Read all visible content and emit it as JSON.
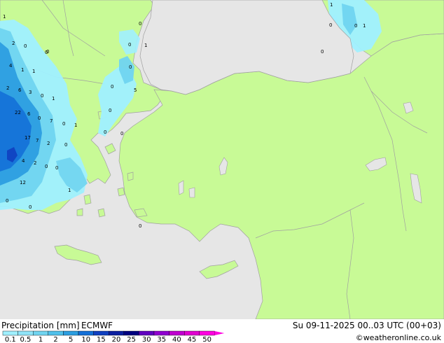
{
  "legend": {
    "title": "Precipitation [mm]",
    "model": "ECMWF",
    "datetime": "Su 09-11-2025 00..03 UTC (00+03)",
    "credit": "©weatheronline.co.uk",
    "ticks": [
      "0.1",
      "0.5",
      "1",
      "2",
      "5",
      "10",
      "15",
      "20",
      "25",
      "30",
      "35",
      "40",
      "45",
      "50"
    ],
    "colors": [
      "#a0f0ff",
      "#90e4f8",
      "#70d4f0",
      "#50c0ea",
      "#2c9ee0",
      "#1470d8",
      "#1040c0",
      "#0c20a0",
      "#000080",
      "#6000c0",
      "#9000d0",
      "#c000d0",
      "#e000d0",
      "#ff00e0"
    ]
  },
  "map": {
    "colors": {
      "sea": "#e6e6e6",
      "land": "#c8fa96",
      "border": "#a0a0a0"
    },
    "value_labels": [
      {
        "text": "1"
      },
      {
        "text": "2"
      },
      {
        "text": "0"
      },
      {
        "text": "0"
      },
      {
        "text": "4"
      },
      {
        "text": "1"
      },
      {
        "text": "1"
      },
      {
        "text": "2"
      },
      {
        "text": "6"
      },
      {
        "text": "3"
      },
      {
        "text": "0"
      },
      {
        "text": "1"
      },
      {
        "text": "22"
      },
      {
        "text": "6"
      },
      {
        "text": "17"
      },
      {
        "text": "0"
      },
      {
        "text": "7"
      },
      {
        "text": "4"
      },
      {
        "text": "2"
      },
      {
        "text": "7"
      },
      {
        "text": "2"
      },
      {
        "text": "0"
      },
      {
        "text": "12"
      },
      {
        "text": "0"
      },
      {
        "text": "0"
      },
      {
        "text": "0"
      },
      {
        "text": "1"
      },
      {
        "text": "0"
      },
      {
        "text": "0"
      },
      {
        "text": "1"
      },
      {
        "text": "0"
      },
      {
        "text": "0"
      },
      {
        "text": "0"
      },
      {
        "text": "0"
      },
      {
        "text": "1"
      },
      {
        "text": "5"
      },
      {
        "text": "0"
      },
      {
        "text": "0"
      },
      {
        "text": "0"
      },
      {
        "text": "0"
      },
      {
        "text": "0"
      },
      {
        "text": "1"
      },
      {
        "text": "0"
      },
      {
        "text": "1"
      },
      {
        "text": "0"
      },
      {
        "text": "0"
      }
    ]
  }
}
